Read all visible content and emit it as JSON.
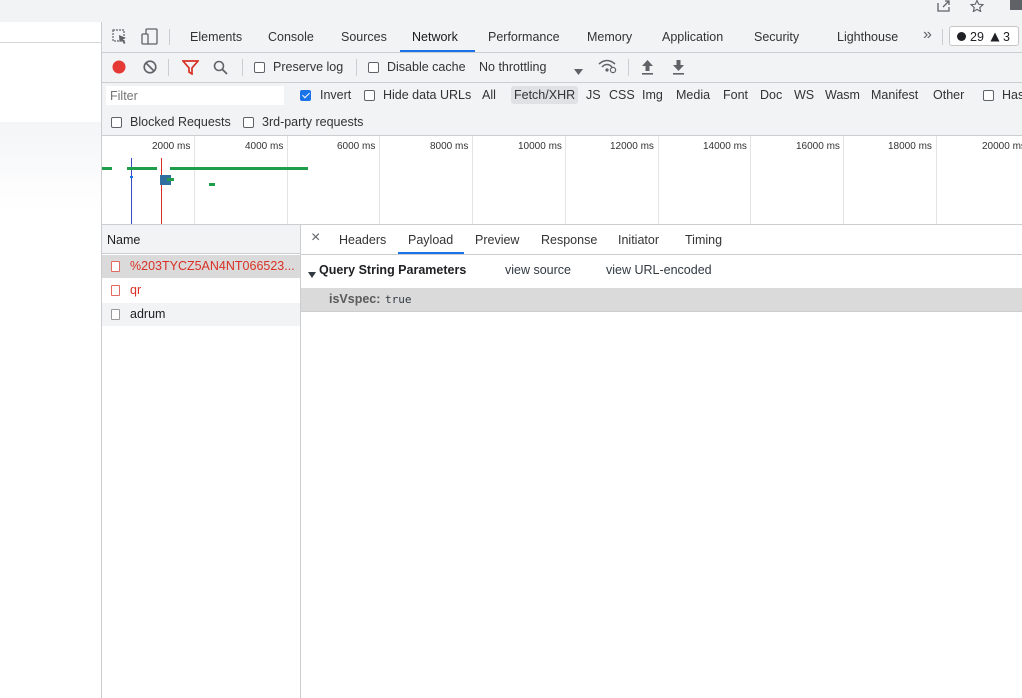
{
  "devtools": {
    "tabs": [
      "Elements",
      "Console",
      "Sources",
      "Network",
      "Performance",
      "Memory",
      "Application",
      "Security",
      "Lighthouse"
    ],
    "active_tab": "Network",
    "more_tabs_glyph": "»",
    "errors_count": "29",
    "warnings_count": "3"
  },
  "toolbar": {
    "preserve_log": "Preserve log",
    "disable_cache": "Disable cache",
    "throttling": "No throttling"
  },
  "filter": {
    "placeholder": "Filter",
    "invert": "Invert",
    "hide_data_urls": "Hide data URLs",
    "types": [
      "All",
      "Fetch/XHR",
      "JS",
      "CSS",
      "Img",
      "Media",
      "Font",
      "Doc",
      "WS",
      "Wasm",
      "Manifest",
      "Other"
    ],
    "active_type": "Fetch/XHR",
    "has_blocked_cookies": "Has",
    "blocked_requests": "Blocked Requests",
    "third_party": "3rd-party requests"
  },
  "overview": {
    "ticks": [
      "2000 ms",
      "4000 ms",
      "6000 ms",
      "8000 ms",
      "10000 ms",
      "12000 ms",
      "14000 ms",
      "16000 ms",
      "18000 ms",
      "20000 ms"
    ]
  },
  "requests": {
    "header": "Name",
    "items": [
      {
        "name": "%203TYCZ5AN4NT066523...",
        "status": "error"
      },
      {
        "name": "qr",
        "status": "error"
      },
      {
        "name": "adrum",
        "status": "ok"
      }
    ]
  },
  "detail": {
    "close_glyph": "×",
    "tabs": [
      "Headers",
      "Payload",
      "Preview",
      "Response",
      "Initiator",
      "Timing"
    ],
    "active_tab": "Payload",
    "section_title": "Query String Parameters",
    "view_source": "view source",
    "view_url_encoded": "view URL-encoded",
    "params": [
      {
        "key": "isVspec:",
        "value": "true"
      }
    ]
  },
  "colors": {
    "accent": "#1a73e8",
    "record": "#e53935",
    "error_text": "#d93025",
    "waterfall_green": "#1e9e4a"
  }
}
